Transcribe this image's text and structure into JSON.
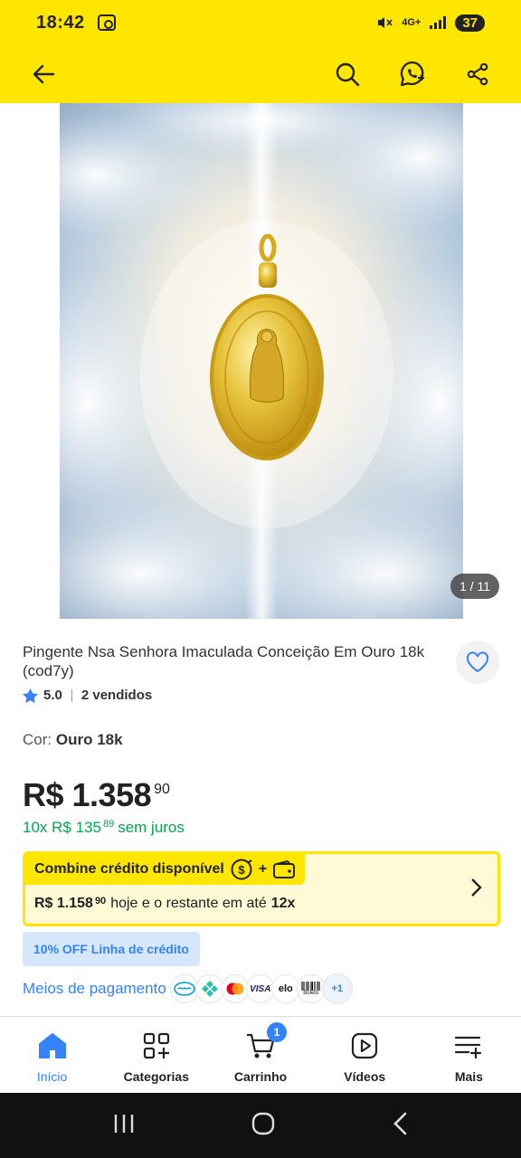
{
  "status_bar": {
    "time": "18:42",
    "network": "4G+",
    "battery": "37"
  },
  "gallery": {
    "counter": "1 / 11"
  },
  "product": {
    "title": "Pingente Nsa Senhora Imaculada Conceição Em Ouro 18k (cod7y)",
    "rating": "5.0",
    "sold": "2 vendidos",
    "color_label": "Cor:",
    "color_value": "Ouro 18k"
  },
  "price": {
    "main": "R$ 1.358",
    "cents": "90",
    "installment_prefix": "10x R$ 135",
    "installment_cents": "89",
    "installment_suffix": "sem juros"
  },
  "credit": {
    "title": "Combine crédito disponível",
    "plus": "+",
    "amount": "R$ 1.158",
    "amount_cents": "90",
    "middle": "hoje e o restante em até",
    "installments": "12x"
  },
  "promo_badge": "10% OFF Linha de crédito",
  "payments": {
    "label": "Meios de pagamento",
    "methods": [
      "mercadopago",
      "pix",
      "mastercard",
      "VISA",
      "elo",
      "Boleto"
    ],
    "more": "+1"
  },
  "tabs": [
    {
      "label": "Início",
      "icon": "home-icon"
    },
    {
      "label": "Categorias",
      "icon": "categories-icon"
    },
    {
      "label": "Carrinho",
      "icon": "cart-icon",
      "badge": "1"
    },
    {
      "label": "Vídeos",
      "icon": "video-icon"
    },
    {
      "label": "Mais",
      "icon": "more-icon"
    }
  ],
  "colors": {
    "brand_yellow": "#ffe600",
    "accent_blue": "#3483fa",
    "green": "#00a650"
  }
}
